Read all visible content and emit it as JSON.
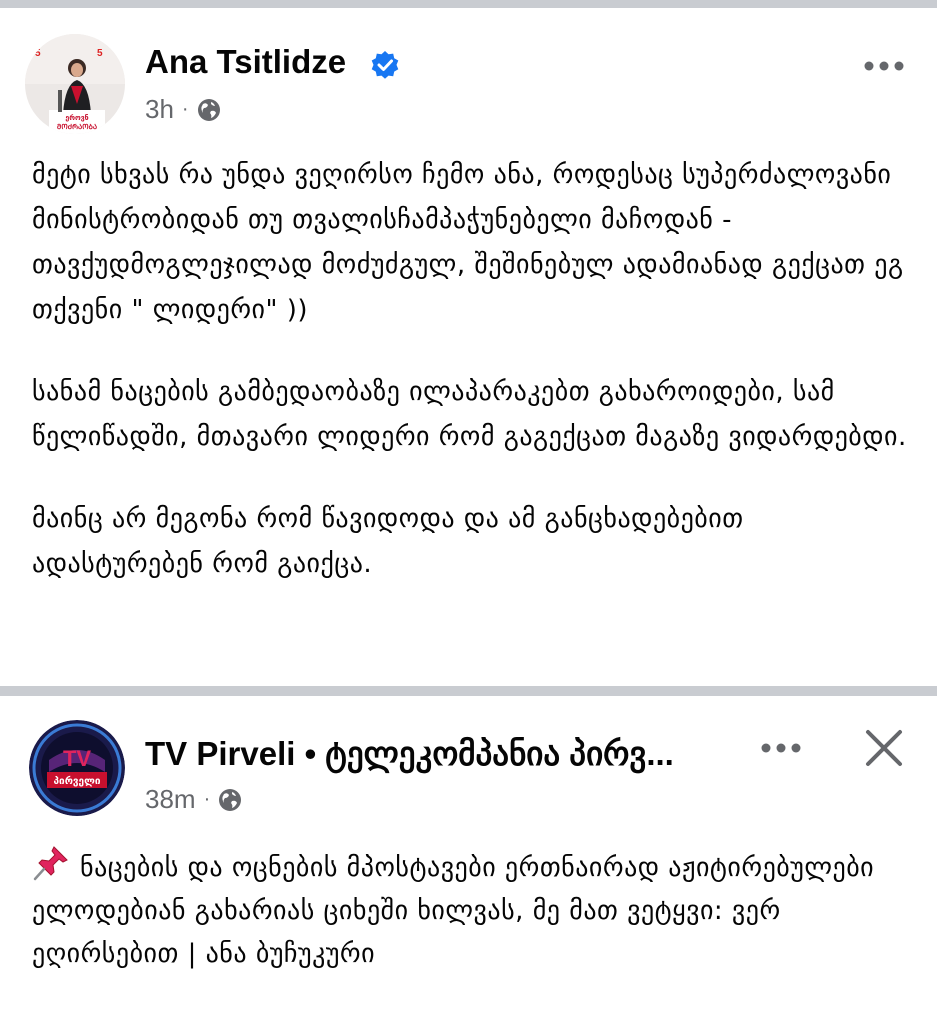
{
  "post1": {
    "author": "Ana Tsitlidze",
    "time": "3h",
    "separator": "·",
    "paragraphs": [
      "მეტი სხვას რა უნდა ვეღირსო ჩემო ანა, როდესაც სუპერძალოვანი მინისტრობიდან თუ თვალისჩამპაჭუნებელი მაჩოდან - თავქუდმოგლეჯილად მოძუძგულ, შეშინებულ ადამიანად გექცათ ეგ თქვენი \" ლიდერი\" ))",
      "სანამ ნაცების გამბედაობაზე ილაპარაკებთ გახაროიდები, სამ წელიწადში, მთავარი ლიდერი რომ გაგექცათ მაგაზე ვიდარდებდი.",
      "მაინც არ მეგონა რომ წავიდოდა და ამ განცხადებებით ადასტურებენ რომ გაიქცა."
    ],
    "icons": {
      "verified": "verified-badge-icon",
      "audience": "globe-icon",
      "menu": "more-icon"
    },
    "colors": {
      "verified": "#1877f2",
      "meta": "#65676b"
    }
  },
  "post2": {
    "author": "TV Pirveli • ტელეკომპანია პირვ...",
    "time": "38m",
    "separator": "·",
    "body": "ნაცების და ოცნების მპოსტავები ერთნაირად აჟიტირებულები ელოდებიან გახარიას ციხეში ხილვას, მე მათ ვეტყვი: ვერ ეღირსებით | ანა ბუჩუკური",
    "avatar_text": "პირველი",
    "icons": {
      "pin": "pushpin-icon",
      "audience": "globe-icon",
      "menu": "more-icon",
      "close": "close-icon"
    }
  }
}
